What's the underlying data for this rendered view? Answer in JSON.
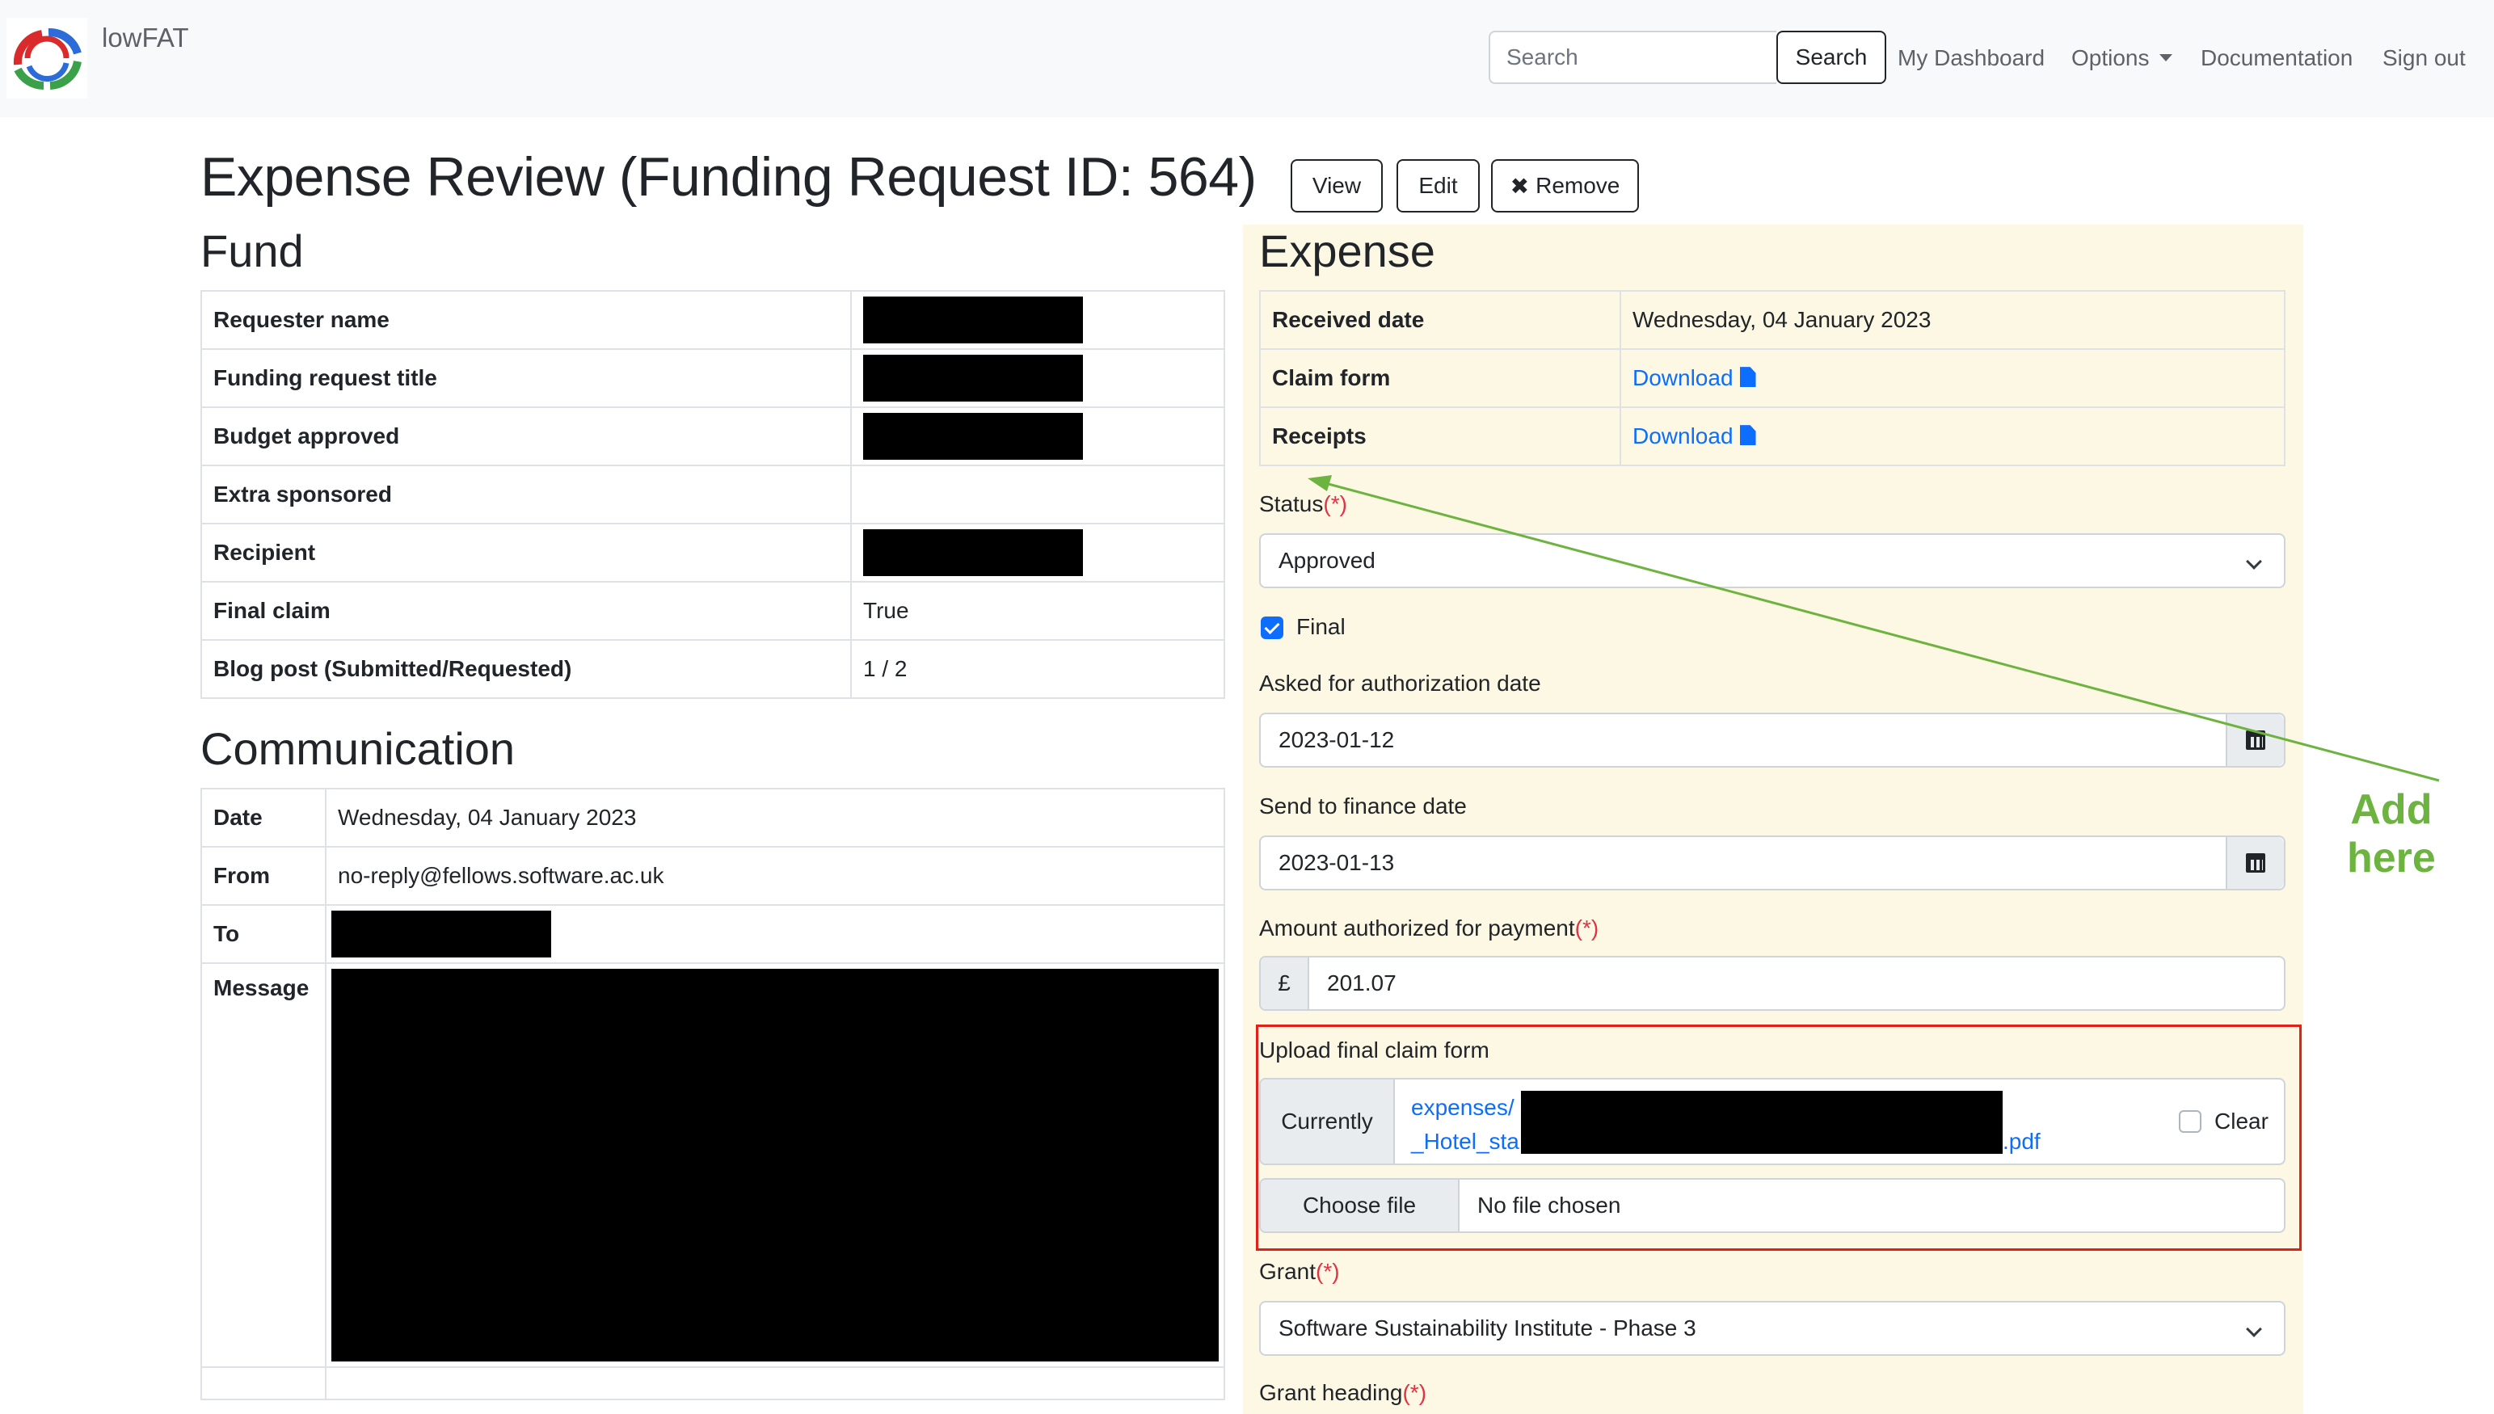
{
  "navbar": {
    "brand": "lowFAT",
    "search_placeholder": "Search",
    "search_button": "Search",
    "links": {
      "dashboard": "My Dashboard",
      "options": "Options",
      "documentation": "Documentation",
      "signout": "Sign out"
    }
  },
  "page": {
    "title": "Expense Review (Funding Request ID: 564)",
    "buttons": {
      "view": "View",
      "edit": "Edit",
      "remove": "Remove",
      "remove_icon": "✖"
    }
  },
  "fund": {
    "heading": "Fund",
    "rows": [
      {
        "key": "Requester name",
        "value": ""
      },
      {
        "key": "Funding request title",
        "value": ""
      },
      {
        "key": "Budget approved",
        "value": ""
      },
      {
        "key": "Extra sponsored",
        "value": ""
      },
      {
        "key": "Recipient",
        "value": ""
      },
      {
        "key": "Final claim",
        "value": "True"
      },
      {
        "key": "Blog post (Submitted/Requested)",
        "value": "1 / 2"
      }
    ]
  },
  "communication": {
    "heading": "Communication",
    "rows": [
      {
        "key": "Date",
        "value": "Wednesday, 04 January 2023"
      },
      {
        "key": "From",
        "value": "no-reply@fellows.software.ac.uk"
      },
      {
        "key": "To",
        "value": ""
      },
      {
        "key": "Message",
        "value": ""
      }
    ]
  },
  "expense": {
    "heading": "Expense",
    "rows": [
      {
        "key": "Received date",
        "value": "Wednesday, 04 January 2023"
      },
      {
        "key": "Claim form",
        "value": "Download"
      },
      {
        "key": "Receipts",
        "value": "Download"
      }
    ],
    "status": {
      "label": "Status",
      "required": "(*)",
      "value": "Approved"
    },
    "final": {
      "label": "Final",
      "checked": true
    },
    "asked_date": {
      "label": "Asked for authorization date",
      "value": "2023-01-12"
    },
    "finance_date": {
      "label": "Send to finance date",
      "value": "2023-01-13"
    },
    "amount": {
      "label": "Amount authorized for payment",
      "required": "(*)",
      "currency": "£",
      "value": "201.07"
    },
    "upload": {
      "label": "Upload final claim form",
      "currently": "Currently",
      "file_line1": "expenses/",
      "file_line2": "_Hotel_sta",
      "file_ext": ".pdf",
      "clear": "Clear",
      "choose": "Choose file",
      "no_file": "No file chosen"
    },
    "grant": {
      "label": "Grant",
      "required": "(*)",
      "value": "Software Sustainability Institute - Phase 3"
    },
    "grant_heading": {
      "label": "Grant heading",
      "required": "(*)"
    }
  },
  "annotation": {
    "line1": "Add",
    "line2": "here",
    "color": "#6db33f"
  }
}
